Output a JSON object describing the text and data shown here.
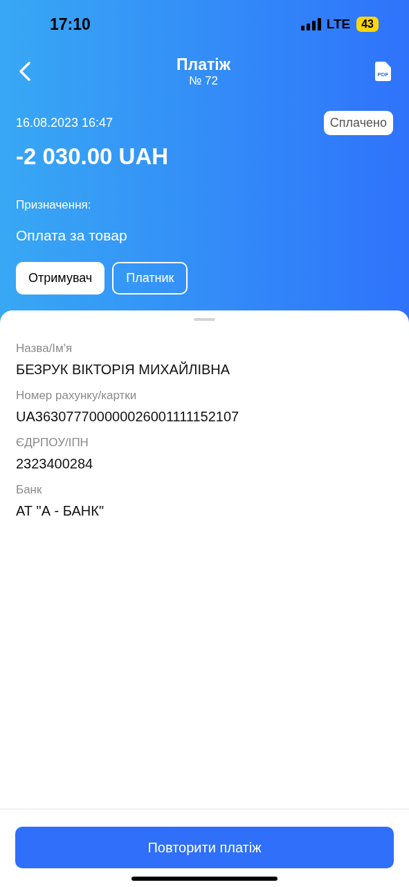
{
  "status_bar": {
    "time": "17:10",
    "network": "LTE",
    "battery": "43"
  },
  "header": {
    "title": "Платіж",
    "subtitle": "№ 72",
    "pdf_label": "PDF"
  },
  "payment": {
    "datetime": "16.08.2023 16:47",
    "status": "Сплачено",
    "amount": "-2 030.00 UAH",
    "purpose_label": "Призначення:",
    "purpose": "Оплата за товар"
  },
  "tabs": [
    {
      "label": "Отримувач",
      "selected": true
    },
    {
      "label": "Платник",
      "selected": false
    }
  ],
  "fields": [
    {
      "label": "Назва/Ім'я",
      "value": "БЕЗРУК ВІКТОРІЯ МИХАЙЛІВНА"
    },
    {
      "label": "Номер рахунку/картки",
      "value": "UA363077700000026001111152107"
    },
    {
      "label": "ЄДРПОУ/ІПН",
      "value": "2323400284"
    },
    {
      "label": "Банк",
      "value": "АТ \"А - БАНК\""
    }
  ],
  "repeat_button": "Повторити платіж"
}
